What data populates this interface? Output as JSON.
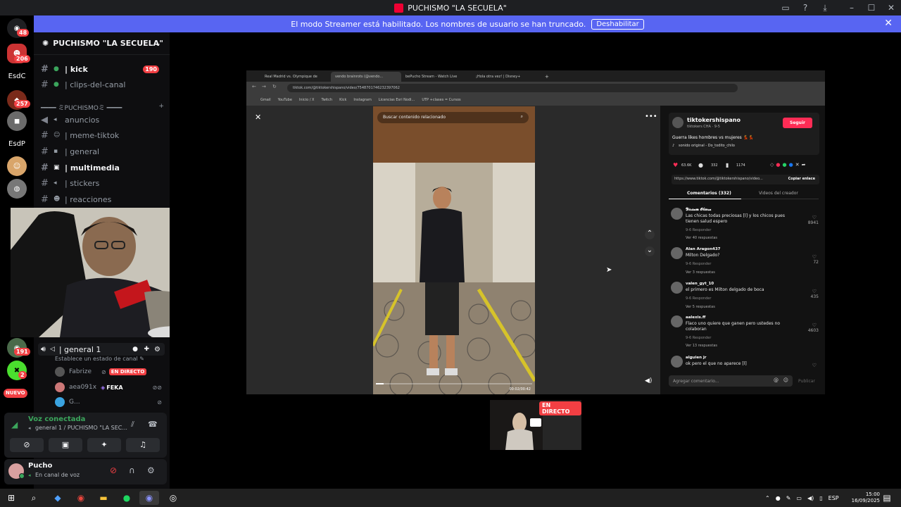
{
  "window": {
    "title": "PUCHISMO \"LA SECUELA\""
  },
  "banner": {
    "text": "El modo Streamer está habilitado. Los nombres de usuario se han truncado.",
    "button": "Deshabilitar"
  },
  "rail": {
    "dm_badge": "48",
    "servers": [
      {
        "label": "",
        "badge": "206"
      },
      {
        "label": "EsdC",
        "badge": ""
      },
      {
        "label": "",
        "badge": "257"
      },
      {
        "label": "EsdP",
        "badge": ""
      },
      {
        "label": "",
        "badge": "191"
      },
      {
        "label": "",
        "badge": "2"
      }
    ],
    "new_label": "NUEVO"
  },
  "sidebar": {
    "server_name": "PUCHISMO \"LA SECUELA\"",
    "channels_top": [
      {
        "name": "| kick",
        "badge": "190",
        "bold": true
      },
      {
        "name": "| clips-del-canal",
        "badge": "",
        "bold": false
      }
    ],
    "category": "━━━━ ミPUCHISMOミ ━━━━",
    "channels": [
      {
        "name": "anuncios",
        "bold": false
      },
      {
        "name": "| meme-tiktok",
        "bold": false
      },
      {
        "name": "| general",
        "bold": false
      },
      {
        "name": "| multimedia",
        "bold": true
      },
      {
        "name": "| stickers",
        "bold": false
      },
      {
        "name": "| reacciones",
        "bold": false
      }
    ]
  },
  "voice": {
    "channel": "| general 1",
    "status_placeholder": "Establece un estado de canal",
    "members": [
      {
        "name": "Fabrize",
        "live": "EN DIRECTO",
        "tag": ""
      },
      {
        "name": "aea091x",
        "live": "",
        "tag": "FEKA"
      },
      {
        "name": "G...",
        "live": "",
        "tag": ""
      }
    ]
  },
  "connection": {
    "status": "Voz conectada",
    "location": "general 1 / PUCHISMO \"LA SEC..."
  },
  "user": {
    "name": "Pucho",
    "status": "En canal de voz"
  },
  "browser": {
    "tabs": [
      "Real Madrid vs. Olympique de",
      "vendo brainrots (@vendo...",
      "bePucho Stream - Watch Live",
      "¡Hola otra vez! | Disney+"
    ],
    "url": "tiktok.com/@tiktokershispano/video/7548701746232397062",
    "bookmarks": [
      "Gmail",
      "YouTube",
      "Inicio / X",
      "Twitch",
      "Kick",
      "Instagram",
      "Licencias Esri Nodi...",
      "UTP +clases = Cursos"
    ],
    "search_placeholder": "Buscar contenido relacionado",
    "video_time": "00:02/00:42",
    "author": {
      "handle": "tiktokershispano",
      "sub": "tiktokers CHA · 9-5",
      "follow": "Seguir"
    },
    "caption": "Guerra likes hombres vs mujeres 💃💃",
    "sound": "sonido original - Do_todito_chilo",
    "stats": {
      "likes": "63.6K",
      "comments": "332",
      "saves": "1174"
    },
    "link": "https://www.tiktok.com/@tiktokershispano/video...",
    "copy_link": "Copiar enlace",
    "tab_comments": "Comentarios (332)",
    "tab_videos": "Videos del creador",
    "comments": [
      {
        "user": "𝓨𝓲𝓻𝓲𝓪𝓶 𝓞𝓵𝓲𝓮𝓻𝓪",
        "text": "Las chicas todas preciosas [l] y los chicos pues tienen salud espero",
        "meta": "9-6     Responder",
        "replies": "Ver 40 respuestas",
        "likes": "8941"
      },
      {
        "user": "Alan Aragon437",
        "text": "Milton Delgado?",
        "meta": "9-6     Responder",
        "replies": "Ver 3 respuestas",
        "likes": "72"
      },
      {
        "user": "valen_gyt_10",
        "text": "el primero es Milton delgado de boca",
        "meta": "9-6     Responder",
        "replies": "Ver 5 respuestas",
        "likes": "435"
      },
      {
        "user": "aalexis.ff",
        "text": "Flaco uno quiere que ganen pero ustedes no colaboran",
        "meta": "9-6     Responder",
        "replies": "Ver 13 respuestas",
        "likes": "4603"
      },
      {
        "user": "alguien jr",
        "text": "ok pero el que no aparece [l]",
        "meta": "",
        "replies": "",
        "likes": ""
      }
    ],
    "add_comment": "Agregar comentario...",
    "publish": "Publicar"
  },
  "thumb": {
    "live": "EN DIRECTO"
  },
  "taskbar": {
    "lang": "ESP",
    "time": "15:00",
    "date": "16/09/2025"
  }
}
